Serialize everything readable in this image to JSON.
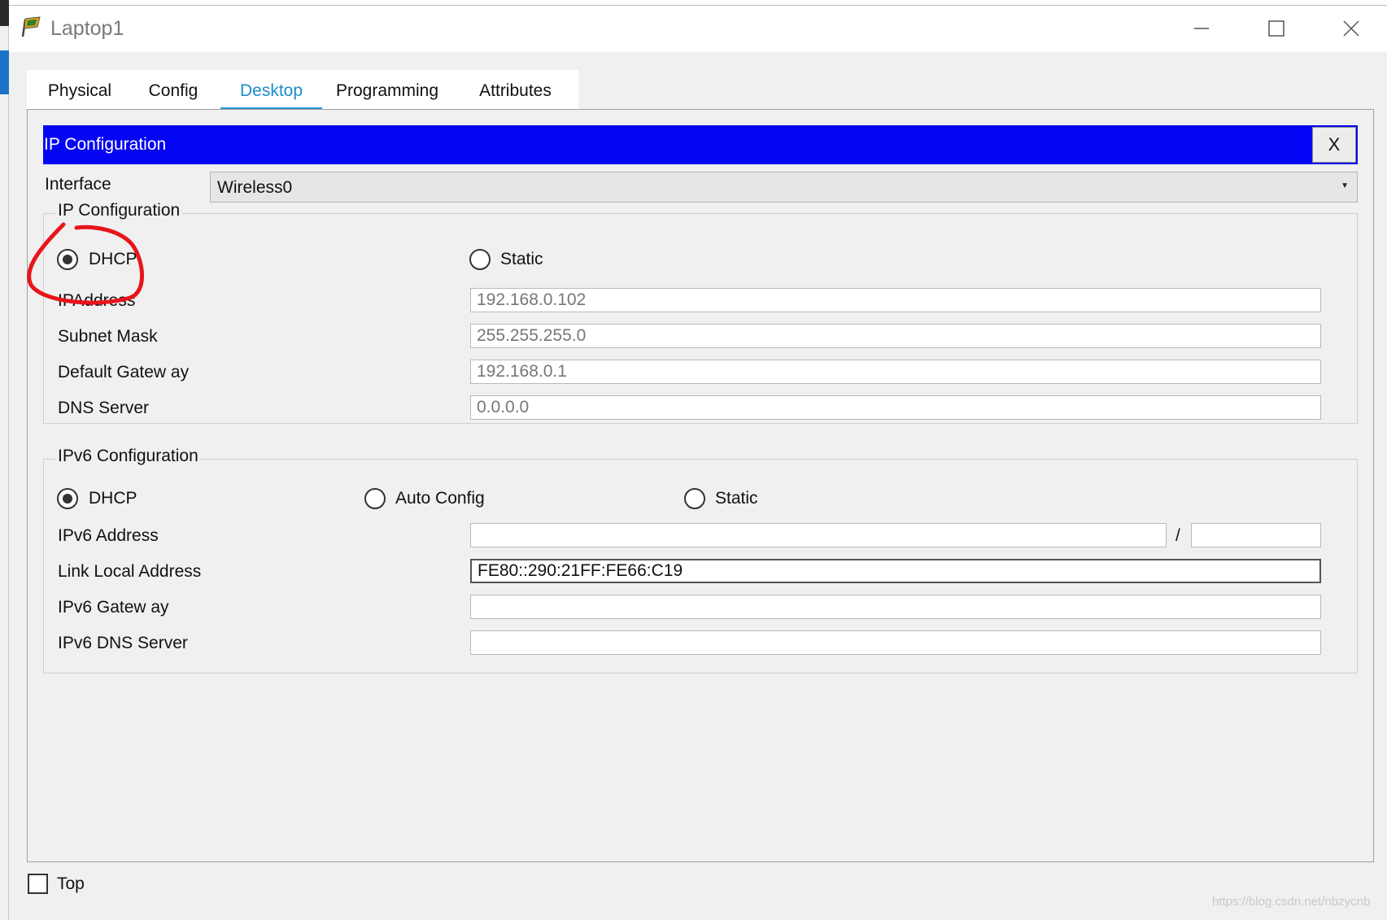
{
  "window": {
    "title": "Laptop1",
    "minimize_icon": "minimize-icon",
    "maximize_icon": "maximize-icon",
    "close_icon": "close-icon"
  },
  "tabs": [
    {
      "label": "Physical",
      "active": false
    },
    {
      "label": "Config",
      "active": false
    },
    {
      "label": "Desktop",
      "active": true
    },
    {
      "label": "Programming",
      "active": false
    },
    {
      "label": "Attributes",
      "active": false
    }
  ],
  "ip_config": {
    "header_title": "IP Configuration",
    "header_close": "X",
    "header_color": "#0505f5",
    "interface_label": "Interface",
    "interface_value": "Wireless0",
    "ipv4": {
      "group_title": "IP Configuration",
      "mode_options": [
        "DHCP",
        "Static"
      ],
      "selected_mode": "DHCP",
      "ip_address_label": "IPAddress",
      "ip_address_value": "192.168.0.102",
      "subnet_mask_label": "Subnet Mask",
      "subnet_mask_value": "255.255.255.0",
      "default_gateway_label": "Default Gatew ay",
      "default_gateway_value": "192.168.0.1",
      "dns_server_label": "DNS Server",
      "dns_server_value": "0.0.0.0"
    },
    "ipv6": {
      "group_title": "IPv6 Configuration",
      "mode_options": [
        "DHCP",
        "Auto Config",
        "Static"
      ],
      "selected_mode": "DHCP",
      "address_label": "IPv6 Address",
      "address_value": "",
      "prefix_separator": "/",
      "prefix_value": "",
      "link_local_label": "Link Local Address",
      "link_local_value": "FE80::290:21FF:FE66:C19",
      "gateway_label": "IPv6 Gatew ay",
      "gateway_value": "",
      "dns_label": "IPv6 DNS Server",
      "dns_value": ""
    }
  },
  "footer": {
    "top_checkbox_label": "Top",
    "top_checked": false
  },
  "annotation": {
    "color": "#e8141c"
  },
  "watermark": "https://blog.csdn.net/nbzycnb"
}
